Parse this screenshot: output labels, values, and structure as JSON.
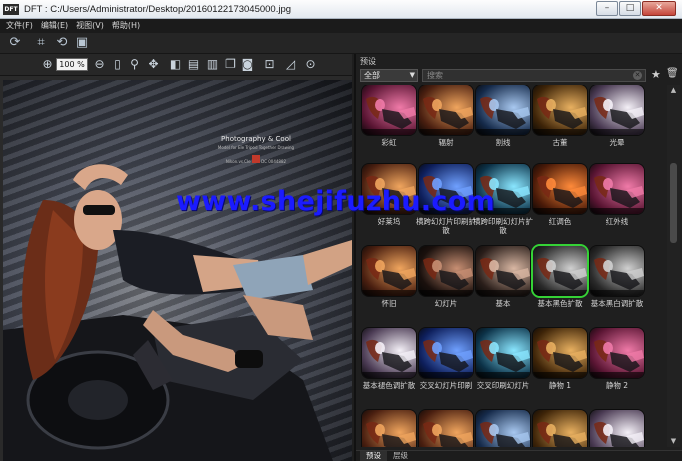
{
  "window": {
    "app_badge": "DFT",
    "title": "DFT : C:/Users/Administrator/Desktop/20160122173045000.jpg",
    "minimize": "–",
    "maximize": "□",
    "close": "✕"
  },
  "menu": [
    "文件(F)",
    "编辑(E)",
    "视图(V)",
    "帮助(H)"
  ],
  "toolbar": {
    "icons": [
      "refresh-icon",
      "crop-icon",
      "rotate-icon",
      "fit-screen-icon"
    ]
  },
  "viewer_toolbar": {
    "zoom_value": "100 %",
    "icons": [
      "zoom-in-icon",
      "zoom-out-icon",
      "info-icon",
      "search-icon",
      "move-icon",
      "split-view-icon",
      "compare-icon",
      "single-view-icon",
      "duplicate-icon",
      "camera-icon",
      "fit-icon",
      "histogram-icon",
      "zoom-fit-icon"
    ]
  },
  "photo": {
    "caption_title": "Photography & Cool",
    "caption_sub": "Model for Ele Tripod Together Drawing",
    "caption_meta_1": "Nikon.vs.Cle",
    "caption_meta_2": "DC 0044882"
  },
  "presets": {
    "panel_title": "预设",
    "category_selected": "全部",
    "search_placeholder": "搜索",
    "items": [
      {
        "label": "彩虹",
        "tone": "pink"
      },
      {
        "label": "辐射",
        "tone": "warm"
      },
      {
        "label": "割线",
        "tone": "cool"
      },
      {
        "label": "古董",
        "tone": "sepia"
      },
      {
        "label": "光晕",
        "tone": "bright"
      },
      {
        "label": "好莱坞",
        "tone": "warm"
      },
      {
        "label": "横跨幻灯片印刷扩散",
        "tone": "blue"
      },
      {
        "label": "横跨印刷幻灯片扩散",
        "tone": "cyan"
      },
      {
        "label": "红调色",
        "tone": "orange"
      },
      {
        "label": "红外线",
        "tone": "pink"
      },
      {
        "label": "怀旧",
        "tone": "warm"
      },
      {
        "label": "幻灯片",
        "tone": "dark"
      },
      {
        "label": "基本",
        "tone": "neutral"
      },
      {
        "label": "基本黑色扩散",
        "tone": "gray",
        "selected": true
      },
      {
        "label": "基本黑白调扩散",
        "tone": "gray"
      },
      {
        "label": "基本褪色调扩散",
        "tone": "bright"
      },
      {
        "label": "交叉幻灯片印刷",
        "tone": "blue"
      },
      {
        "label": "交叉印刷幻灯片",
        "tone": "cyan"
      },
      {
        "label": "静物 1",
        "tone": "sepia"
      },
      {
        "label": "静物 2",
        "tone": "pink"
      },
      {
        "label": "",
        "tone": "warm"
      },
      {
        "label": "",
        "tone": "warm"
      },
      {
        "label": "",
        "tone": "cool"
      },
      {
        "label": "",
        "tone": "sepia"
      },
      {
        "label": "",
        "tone": "bright"
      }
    ]
  },
  "bottom_tabs": [
    "预设",
    "层级"
  ],
  "overlay_watermark": "www.shejifuzhu.com",
  "colors": {
    "selection": "#35d236",
    "watermark": "#1b1bff"
  }
}
